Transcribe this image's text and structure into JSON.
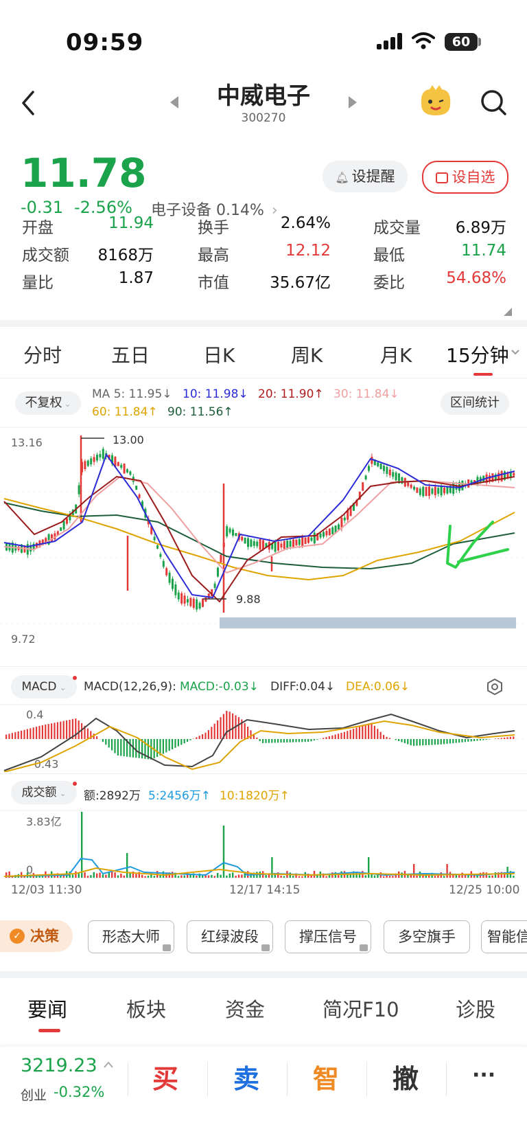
{
  "status": {
    "time": "09:59",
    "battery": "60"
  },
  "nav": {
    "title": "中威电子",
    "code": "300270"
  },
  "quote": {
    "price": "11.78",
    "change": "-0.31",
    "change_pct": "-2.56%",
    "sector": "电子设备 0.14%",
    "sector_arrow": "›",
    "remind_label": "设提醒",
    "watch_label": "设自选",
    "stats": [
      {
        "label": "开盘",
        "value": "11.94"
      },
      {
        "label": "换手",
        "value": "2.64%"
      },
      {
        "label": "成交量",
        "value": "6.89万"
      },
      {
        "label": "成交额",
        "value": "8168万"
      },
      {
        "label": "最高",
        "value": "12.12"
      },
      {
        "label": "最低",
        "value": "11.74"
      },
      {
        "label": "量比",
        "value": "1.87"
      },
      {
        "label": "市值",
        "value": "35.67亿"
      },
      {
        "label": "委比",
        "value": "54.68%"
      }
    ]
  },
  "tabs": [
    "分时",
    "五日",
    "日K",
    "周K",
    "月K",
    "15分钟"
  ],
  "tabs_selected": "15分钟",
  "chart_header": {
    "adjust": "不复权",
    "ma5": "MA 5: 11.95↓",
    "ma10": "10: 11.98↓",
    "ma20": "20: 11.90↑",
    "ma30": "30: 11.84↓",
    "ma60": "60: 11.84↑",
    "ma90": "90: 11.56↑",
    "range_stats": "区间统计",
    "y_high": "13.16",
    "y_low": "9.72",
    "mark_high": "13.00",
    "mark_low": "9.88"
  },
  "macd": {
    "label": "MACD",
    "params": "MACD(12,26,9):",
    "macd": "MACD:-0.03↓",
    "diff": "DIFF:0.04↓",
    "dea": "DEA:0.06↓",
    "y_top": "0.4",
    "y_bottom": "-0.43"
  },
  "volume": {
    "label": "成交额",
    "amount": "额:2892万",
    "ma5": "5:2456万↑",
    "ma10": "10:1820万↑",
    "y_top": "3.83亿",
    "y_bottom": "0"
  },
  "time_axis": [
    "12/03 11:30",
    "12/17 14:15",
    "12/25 10:00"
  ],
  "tools": {
    "decision": "决策",
    "items": [
      "形态大师",
      "红绿波段",
      "撑压信号",
      "多空旗手",
      "智能信号"
    ]
  },
  "bottom_tabs": [
    "要闻",
    "板块",
    "资金",
    "简况F10",
    "诊股"
  ],
  "index": {
    "value": "3219.23",
    "name": "创业",
    "change": "-0.32%"
  },
  "actions": {
    "buy": "买",
    "sell": "卖",
    "smart": "智",
    "cancel": "撤",
    "more": "···"
  },
  "colors": {
    "up": "#e33939",
    "down": "#1aa34a",
    "ma5": "#2b2bd6",
    "ma10": "#2b2bd6",
    "ma20": "#9b1a1a",
    "ma30": "#f0a0a0",
    "ma60": "#f0b400",
    "ma90": "#1d5e3a"
  }
}
